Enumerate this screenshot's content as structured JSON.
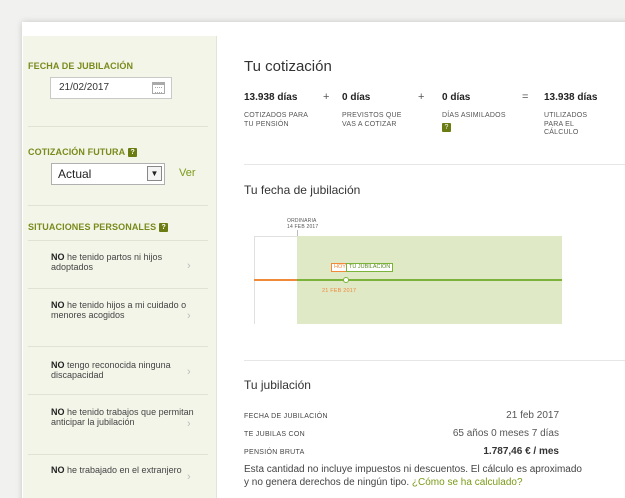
{
  "sidebar": {
    "fecha_title": "FECHA DE JUBILACIÓN",
    "fecha_value": "21/02/2017",
    "cotizacion_title": "COTIZACIÓN FUTURA",
    "cotizacion_selected": "Actual",
    "ver_label": "Ver",
    "situaciones_title": "SITUACIONES PERSONALES",
    "help_glyph": "?",
    "items": [
      {
        "bold": "NO",
        "text": " he tenido partos ni hijos adoptados"
      },
      {
        "bold": "NO",
        "text": " he tenido hijos a mi cuidado o menores acogidos"
      },
      {
        "bold": "NO",
        "text": " tengo reconocida ninguna discapacidad"
      },
      {
        "bold": "NO",
        "text": " he tenido trabajos que permitan anticipar la jubilación"
      },
      {
        "bold": "NO",
        "text": " he trabajado en el extranjero"
      }
    ]
  },
  "main": {
    "title": "Tu cotización",
    "cotizacion": {
      "total1": "13.938 días",
      "plus": "+",
      "equals": "=",
      "previstos": "0 días",
      "asimilados": "0 días",
      "total2": "13.938 días",
      "label1": "COTIZADOS PARA TU PENSIÓN",
      "label2": "PREVISTOS QUE VAS A COTIZAR",
      "label3": "DÍAS ASIMILADOS",
      "label4": "UTILIZADOS PARA EL CÁLCULO"
    },
    "fecha_section_title": "Tu fecha de jubilación",
    "timeline": {
      "ordinaria_label": "ORDINARIA",
      "ordinaria_date": "14 FEB 2017",
      "hoy_label": "HOY",
      "jubilacion_label": "TU JUBILACION",
      "jubilacion_date": "21 FEB 2017"
    },
    "jubilacion_section_title": "Tu jubilación",
    "rows": [
      {
        "label": "FECHA DE JUBILACIÓN",
        "value": "21 feb 2017"
      },
      {
        "label": "TE JUBILAS CON",
        "value": "65 años 0 meses 7 días"
      },
      {
        "label": "PENSIÓN BRUTA",
        "value": "1.787,46 € / mes"
      }
    ],
    "note_line1": "Esta cantidad no incluye impuestos ni descuentos. El cálculo es aproximado",
    "note_line2": "y no genera derechos de ningún tipo.",
    "note_link": "¿Cómo se ha calculado?"
  },
  "colors": {
    "accent_green": "#7a9a16",
    "timeline_orange": "#f08a3a",
    "timeline_green": "#7bb33a"
  }
}
